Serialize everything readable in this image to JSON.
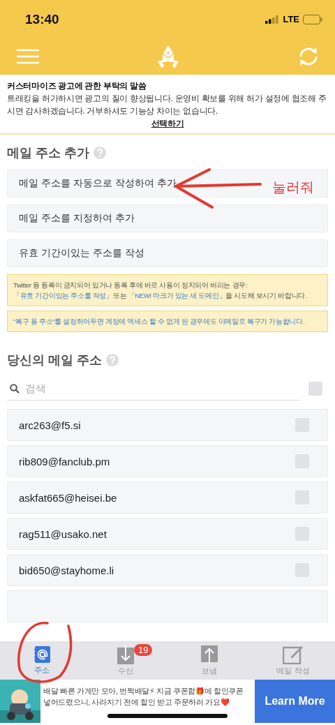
{
  "status_bar": {
    "time": "13:40",
    "network": "LTE"
  },
  "notice": {
    "title": "커스터마이즈 광고에 관한 부탁의 말씀",
    "body": "트래킹을 허가하시면 광고의 질이 향상됩니다. 운영비 확보를 위해 허가 설정에 협조해 주시면 감사하겠습니다. 거부하셔도 기능상 차이는 없습니다.",
    "link": "선택하기"
  },
  "add_section": {
    "title": "메일 주소 추가",
    "options": [
      {
        "label": "메일 주소를 자동으로 작성하여 추가"
      },
      {
        "label": "메일 주소를 지정하여 추가"
      },
      {
        "label": "유효 기간이있는 주소를 작성"
      }
    ],
    "annotation": "눌러줘",
    "tips": [
      {
        "parts": [
          {
            "kind": "text",
            "text": "Twitter 등 등록이 금지되어 있거나 등록 후에 바로 사용이 정지되어 버리는 경우: "
          },
          {
            "kind": "link",
            "text": "「유효 기간이있는 주소를 작성」"
          },
          {
            "kind": "text",
            "text": "또는 "
          },
          {
            "kind": "link",
            "text": "「NEW! 마크가 있는 새 도메인」"
          },
          {
            "kind": "text",
            "text": "을 시도해 보시기 바랍니다."
          }
        ]
      },
      {
        "parts": [
          {
            "kind": "accent",
            "text": "\"복구 용 주소\"를 설정하여두면 계정에 액세스 할 수 없게 된 경우에도 이메일로 복구가 가능합니다."
          }
        ]
      }
    ]
  },
  "address_section": {
    "title": "당신의 메일 주소",
    "search": {
      "placeholder": "검색"
    },
    "select_all": {
      "checked": false
    },
    "addresses": [
      {
        "address": "arc263@f5.si",
        "checked": false
      },
      {
        "address": "rib809@fanclub.pm",
        "checked": false
      },
      {
        "address": "askfat665@heisei.be",
        "checked": false
      },
      {
        "address": "rag511@usako.net",
        "checked": false
      },
      {
        "address": "bid650@stayhome.li",
        "checked": false
      }
    ]
  },
  "tab_bar": [
    {
      "kind": "address",
      "label": "주소",
      "selected": true
    },
    {
      "kind": "inbox",
      "label": "수신",
      "selected": false,
      "badge": "19"
    },
    {
      "kind": "send",
      "label": "보냄",
      "selected": false
    },
    {
      "kind": "compose",
      "label": "메일 작성",
      "selected": false
    }
  ],
  "ad": {
    "kind": "picture",
    "text": "배달 빠른 가게만 모아, 번쩍배달⚡ 지금 쿠폰함🎁에 할인쿠폰 넣어드렸으니, 사라지기 전에 할인 받고 주문하러 가요❤️",
    "button": "Learn More"
  }
}
